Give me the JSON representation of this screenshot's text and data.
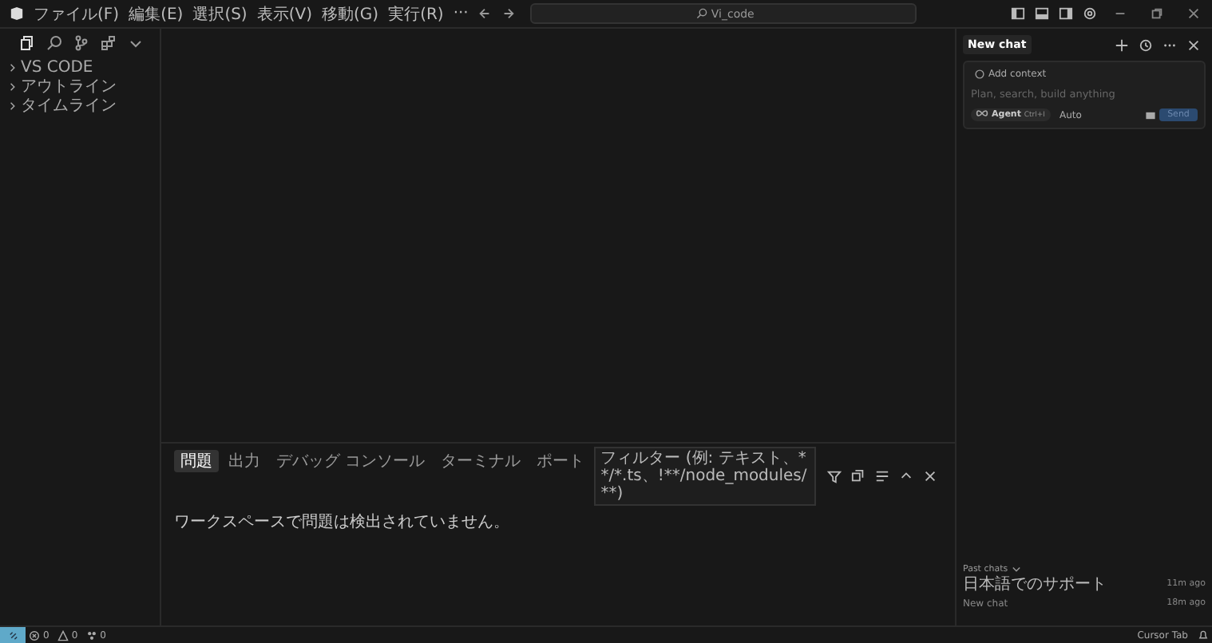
{
  "menu": [
    "ファイル(F)",
    "編集(E)",
    "選択(S)",
    "表示(V)",
    "移動(G)",
    "実行(R)",
    "···"
  ],
  "search": {
    "value": "Vi_code"
  },
  "sidebar": {
    "sections": [
      {
        "label": "VS CODE",
        "expanded": false
      },
      {
        "label": "アウトライン",
        "expanded": false
      },
      {
        "label": "タイムライン",
        "expanded": false
      }
    ]
  },
  "panel": {
    "tabs": [
      {
        "label": "問題",
        "selected": true
      },
      {
        "label": "出力",
        "selected": false
      },
      {
        "label": "デバッグ コンソール",
        "selected": false
      },
      {
        "label": "ターミナル",
        "selected": false
      },
      {
        "label": "ポート",
        "selected": false
      }
    ],
    "filter": {
      "placeholder": "フィルター (例: テキスト、**/*.ts、!**/node_modules/**)"
    },
    "message": "ワークスペースで問題は検出されていません。"
  },
  "chat": {
    "title": "New chat",
    "add_context": "Add context",
    "placeholder": "Plan, search, build anything",
    "mode": "Agent",
    "shortcut": "Ctrl+I",
    "model": "Auto",
    "send": {
      "label": "Send",
      "disabled": true
    },
    "past_chats": {
      "label": "Past chats",
      "items": [
        {
          "title": "日本語でのサポート",
          "time": "11m ago"
        },
        {
          "title": "New chat",
          "time": "18m ago"
        }
      ]
    }
  },
  "status_bar": {
    "errors": "0",
    "warnings": "0",
    "ports": "0",
    "cursor_tab": "Cursor Tab"
  }
}
